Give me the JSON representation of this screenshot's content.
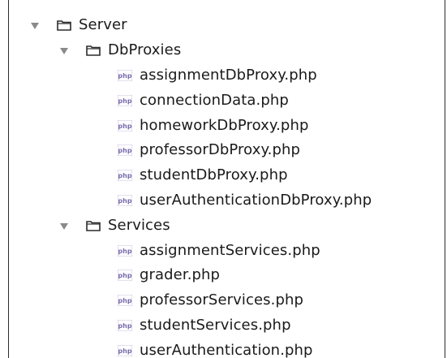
{
  "tree": {
    "root": {
      "label": "Server",
      "icon": "folder-icon",
      "expanded": true
    },
    "folders": [
      {
        "label": "DbProxies",
        "icon": "folder-icon",
        "expanded": true,
        "files": [
          "assignmentDbProxy.php",
          "connectionData.php",
          "homeworkDbProxy.php",
          "professorDbProxy.php",
          "studentDbProxy.php",
          "userAuthenticationDbProxy.php"
        ]
      },
      {
        "label": "Services",
        "icon": "folder-icon",
        "expanded": true,
        "files": [
          "assignmentServices.php",
          "grader.php",
          "professorServices.php",
          "studentServices.php",
          "userAuthentication.php"
        ]
      }
    ],
    "file_icon_text": "php",
    "file_icon": "php-file-icon",
    "colors": {
      "folder_outline": "#2b2b2b",
      "folder_fill": "#ffffff",
      "php_icon": "#7b6cae",
      "arrow": "#8a8a8a"
    }
  }
}
